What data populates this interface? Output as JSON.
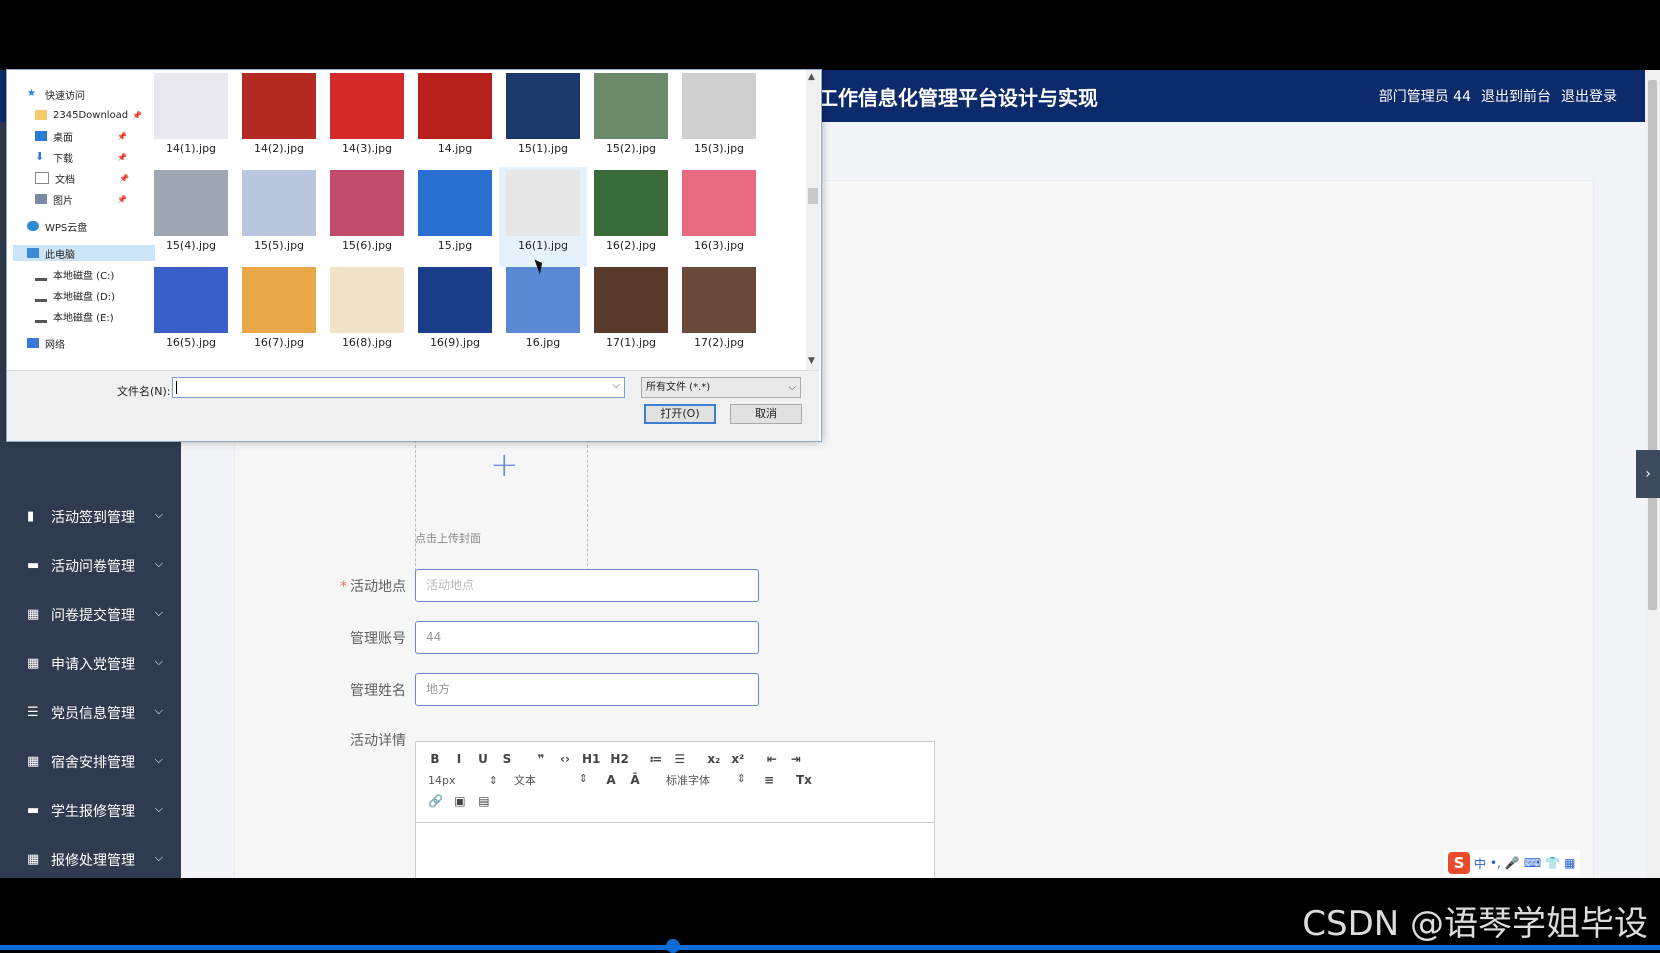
{
  "app": {
    "title": "工作信息化管理平台设计与实现",
    "user_text": "部门管理员 44",
    "links": [
      "退出到前台",
      "退出登录"
    ],
    "menu": [
      {
        "label": "活动签到管理",
        "icon": "chart-icon"
      },
      {
        "label": "活动问卷管理",
        "icon": "monitor-icon"
      },
      {
        "label": "问卷提交管理",
        "icon": "grid-icon"
      },
      {
        "label": "申请入党管理",
        "icon": "table-icon"
      },
      {
        "label": "党员信息管理",
        "icon": "list-icon"
      },
      {
        "label": "宿舍安排管理",
        "icon": "grid-icon"
      },
      {
        "label": "学生报修管理",
        "icon": "monitor-icon"
      },
      {
        "label": "报修处理管理",
        "icon": "grid-icon"
      }
    ],
    "form": {
      "upload_hint": "点击上传封面",
      "upload_plus": "+",
      "location": {
        "label": "活动地点",
        "placeholder": "活动地点"
      },
      "account": {
        "label": "管理账号",
        "value": "44"
      },
      "name": {
        "label": "管理姓名",
        "value": "地方"
      },
      "details_label": "活动详情"
    },
    "editor": {
      "row1": [
        "B",
        "I",
        "U",
        "S",
        "❞",
        "‹›",
        "H1",
        "H2",
        "≔",
        "☰",
        "x₂",
        "x²",
        "⇤",
        "⇥"
      ],
      "font_size": "14px",
      "text_type": "文本",
      "font_family": "标准字体",
      "row3": [
        "🔗",
        "▣",
        "▤"
      ]
    }
  },
  "dialog": {
    "nav": {
      "quick_access": "快速访问",
      "items": [
        {
          "label": "2345Download",
          "pinned": true
        },
        {
          "label": "桌面",
          "pinned": true
        },
        {
          "label": "下载",
          "pinned": true
        },
        {
          "label": "文档",
          "pinned": true
        },
        {
          "label": "图片",
          "pinned": true
        }
      ],
      "cloud": "WPS云盘",
      "this_pc": "此电脑",
      "drives": [
        "本地磁盘 (C:)",
        "本地磁盘 (D:)",
        "本地磁盘 (E:)"
      ],
      "network": "网络"
    },
    "files": [
      {
        "name": "14(1).jpg",
        "color": "#e8e8ee"
      },
      {
        "name": "14(2).jpg",
        "color": "#b22a22"
      },
      {
        "name": "14(3).jpg",
        "color": "#d52a2a"
      },
      {
        "name": "14.jpg",
        "color": "#b8201c"
      },
      {
        "name": "15(1).jpg",
        "color": "#1b3a6b"
      },
      {
        "name": "15(2).jpg",
        "color": "#6b8a6a"
      },
      {
        "name": "15(3).jpg",
        "color": "#cfcfcf"
      },
      {
        "name": "15(4).jpg",
        "color": "#9ea6b4"
      },
      {
        "name": "15(5).jpg",
        "color": "#b8c6de"
      },
      {
        "name": "15(6).jpg",
        "color": "#c24a6a"
      },
      {
        "name": "15.jpg",
        "color": "#2a6fd1"
      },
      {
        "name": "16(1).jpg",
        "color": "#e6e6e6"
      },
      {
        "name": "16(2).jpg",
        "color": "#3a6a3a"
      },
      {
        "name": "16(3).jpg",
        "color": "#e86a80"
      },
      {
        "name": "16(5).jpg",
        "color": "#3a5fc8"
      },
      {
        "name": "16(7).jpg",
        "color": "#e8a84a"
      },
      {
        "name": "16(8).jpg",
        "color": "#f2e2c8"
      },
      {
        "name": "16(9).jpg",
        "color": "#1a3d8a"
      },
      {
        "name": "16.jpg",
        "color": "#5a8ad6"
      },
      {
        "name": "17(1).jpg",
        "color": "#5a3a2a"
      },
      {
        "name": "17(2).jpg",
        "color": "#6a4a3a"
      }
    ],
    "selected_index": 11,
    "filename_label": "文件名(N):",
    "filename_value": "",
    "filetype": "所有文件 (*.*)",
    "open_label": "打开(O)",
    "cancel_label": "取消"
  },
  "ime": {
    "logo": "S",
    "chars": [
      "中",
      "•,",
      "🎤",
      "⌨",
      "👕",
      "▦"
    ]
  },
  "watermark": "CSDN @语琴学姐毕设"
}
